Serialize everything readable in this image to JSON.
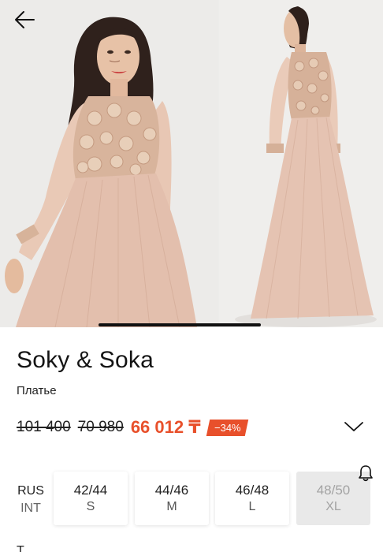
{
  "product": {
    "brand": "Soky & Soka",
    "category": "Платье"
  },
  "price": {
    "original": "101 400",
    "previous": "70 980",
    "current": "66 012 ₸",
    "discount": "−34%",
    "accent_color": "#e8502b"
  },
  "sizes": {
    "system_primary": "RUS",
    "system_secondary": "INT",
    "items": [
      {
        "ru": "42/44",
        "intl": "S",
        "available": true
      },
      {
        "ru": "44/46",
        "intl": "M",
        "available": true
      },
      {
        "ru": "46/48",
        "intl": "L",
        "available": true
      },
      {
        "ru": "48/50",
        "intl": "XL",
        "available": false
      }
    ]
  },
  "next_section": {
    "label": "Т"
  },
  "icons": {
    "back": "arrow-left-icon",
    "expand": "chevron-down-icon",
    "notify": "bell-icon"
  },
  "gallery": {
    "images": [
      "model-front-photo",
      "model-back-photo"
    ]
  }
}
